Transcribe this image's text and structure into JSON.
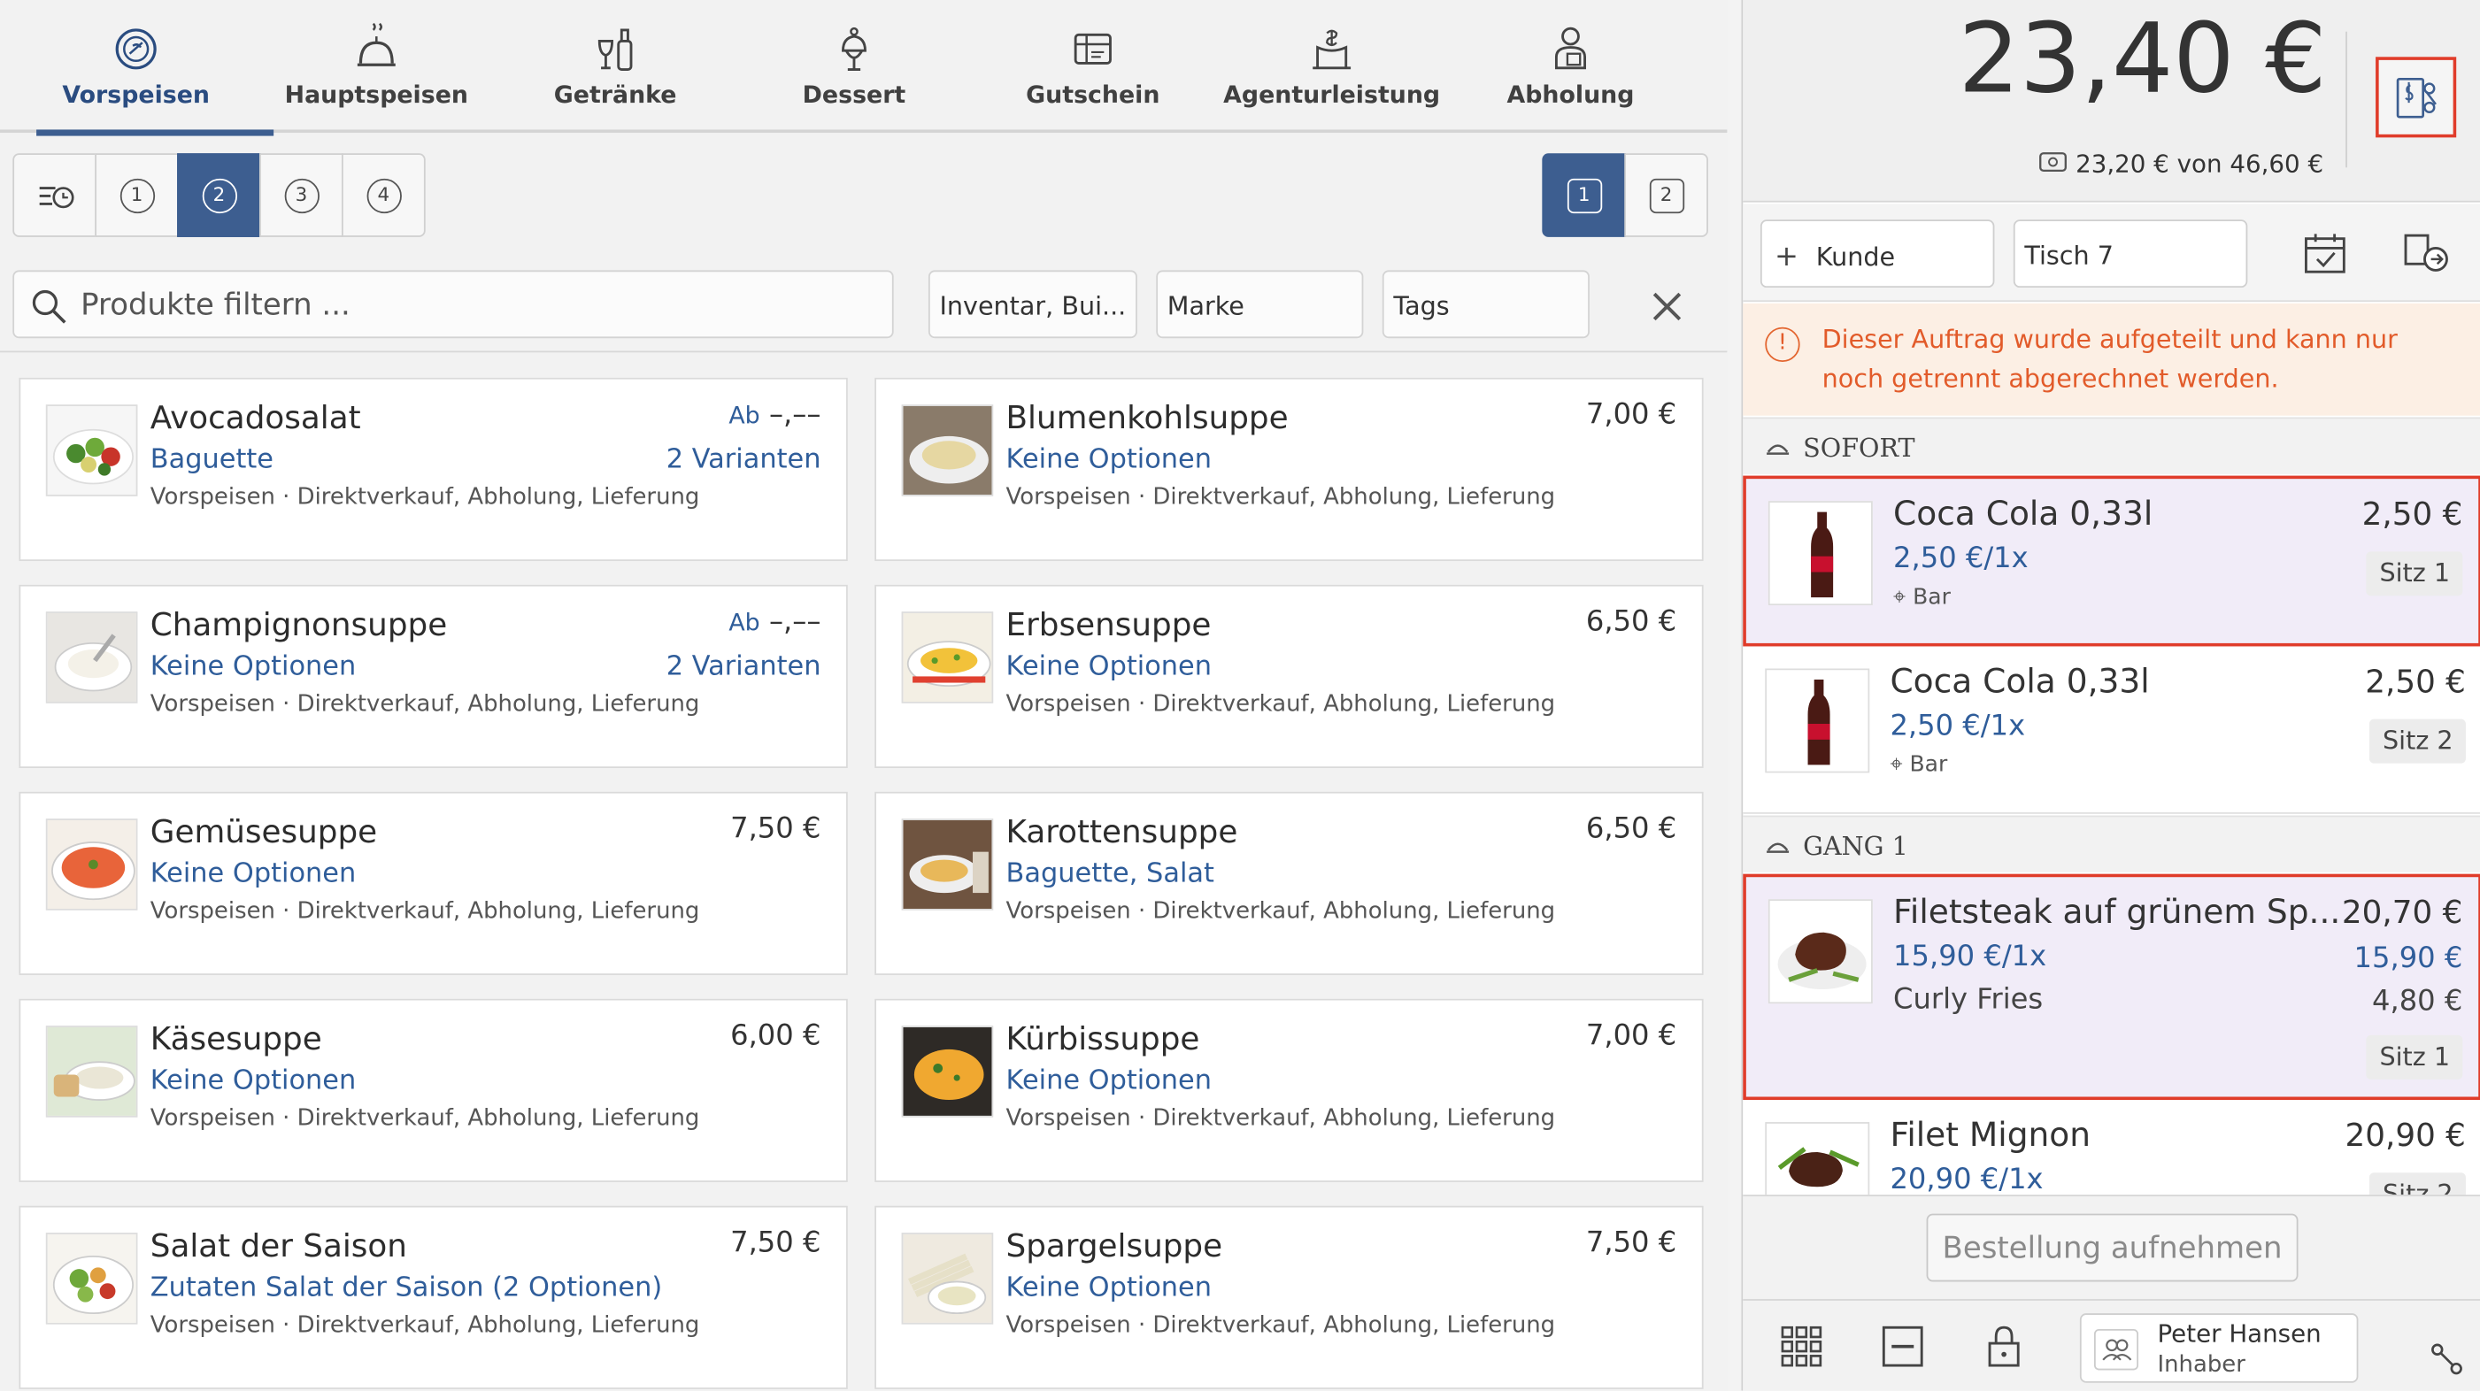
{
  "categories": [
    {
      "label": "Vorspeisen",
      "icon": "salad-bowl-icon",
      "active": true
    },
    {
      "label": "Hauptspeisen",
      "icon": "cloche-icon",
      "active": false
    },
    {
      "label": "Getränke",
      "icon": "drinks-icon",
      "active": false
    },
    {
      "label": "Dessert",
      "icon": "dessert-icon",
      "active": false
    },
    {
      "label": "Gutschein",
      "icon": "voucher-icon",
      "active": false
    },
    {
      "label": "Agenturleistung",
      "icon": "agency-icon",
      "active": false
    },
    {
      "label": "Abholung",
      "icon": "pickup-icon",
      "active": false
    }
  ],
  "courses": [
    "1",
    "2",
    "3",
    "4"
  ],
  "selected_course": "2",
  "seats": [
    "1",
    "2"
  ],
  "selected_seat": "1",
  "search": {
    "placeholder": "Produkte filtern ..."
  },
  "filters": {
    "inventory": "Inventar, Bui...",
    "brand": "Marke",
    "tags": "Tags"
  },
  "products": [
    {
      "name": "Avocadosalat",
      "price_prefix": "Ab",
      "price": "–,––",
      "options": "Baguette",
      "variants": "2 Varianten",
      "meta": "Vorspeisen · Direktverkauf, Abholung, Lieferung",
      "thumb": "salad"
    },
    {
      "name": "Blumenkohlsuppe",
      "price_prefix": "",
      "price": "7,00 €",
      "options": "Keine Optionen",
      "variants": "",
      "meta": "Vorspeisen · Direktverkauf, Abholung, Lieferung",
      "thumb": "creamsoup"
    },
    {
      "name": "Champignonsuppe",
      "price_prefix": "Ab",
      "price": "–,––",
      "options": "Keine Optionen",
      "variants": "2 Varianten",
      "meta": "Vorspeisen · Direktverkauf, Abholung, Lieferung",
      "thumb": "whitesoup"
    },
    {
      "name": "Erbsensuppe",
      "price_prefix": "",
      "price": "6,50 €",
      "options": "Keine Optionen",
      "variants": "",
      "meta": "Vorspeisen · Direktverkauf, Abholung, Lieferung",
      "thumb": "omelette"
    },
    {
      "name": "Gemüsesuppe",
      "price_prefix": "",
      "price": "7,50 €",
      "options": "Keine Optionen",
      "variants": "",
      "meta": "Vorspeisen · Direktverkauf, Abholung, Lieferung",
      "thumb": "tomatosoup"
    },
    {
      "name": "Karottensuppe",
      "price_prefix": "",
      "price": "6,50 €",
      "options": "Baguette, Salat",
      "variants": "",
      "meta": "Vorspeisen · Direktverkauf, Abholung, Lieferung",
      "thumb": "carrotsoup"
    },
    {
      "name": "Käsesuppe",
      "price_prefix": "",
      "price": "6,00 €",
      "options": "Keine Optionen",
      "variants": "",
      "meta": "Vorspeisen · Direktverkauf, Abholung, Lieferung",
      "thumb": "cheesesoup"
    },
    {
      "name": "Kürbissuppe",
      "price_prefix": "",
      "price": "7,00 €",
      "options": "Keine Optionen",
      "variants": "",
      "meta": "Vorspeisen · Direktverkauf, Abholung, Lieferung",
      "thumb": "pumpkinsoup"
    },
    {
      "name": "Salat der Saison",
      "price_prefix": "",
      "price": "7,50 €",
      "options": "Zutaten Salat der Saison (2 Optionen)",
      "variants": "",
      "meta": "Vorspeisen · Direktverkauf, Abholung, Lieferung",
      "thumb": "salad2"
    },
    {
      "name": "Spargelsuppe",
      "price_prefix": "",
      "price": "7,50 €",
      "options": "Keine Optionen",
      "variants": "",
      "meta": "Vorspeisen · Direktverkauf, Abholung, Lieferung",
      "thumb": "asparagus"
    }
  ],
  "order": {
    "total": "23,40 €",
    "paid": "23,20 €",
    "of": "von",
    "gross": "46,60 €",
    "customer_btn": "Kunde",
    "table": "Tisch 7",
    "warning": "Dieser Auftrag wurde aufgeteilt und kann nur noch getrennt abgerechnet werden.",
    "groups": [
      {
        "title": "SOFORT",
        "items": [
          {
            "name": "Coca Cola 0,33l",
            "unit": "2,50 €/1x",
            "location": "Bar",
            "price": "2,50 €",
            "seat": "Sitz 1",
            "highlight": true
          },
          {
            "name": "Coca Cola 0,33l",
            "unit": "2,50 €/1x",
            "location": "Bar",
            "price": "2,50 €",
            "seat": "Sitz 2",
            "highlight": false
          }
        ]
      },
      {
        "title": "GANG 1",
        "items": [
          {
            "name": "Filetsteak auf grünem Sp...",
            "unit": "15,90 €/1x",
            "unit_price": "15,90 €",
            "extra": "Curly Fries",
            "extra_price": "4,80 €",
            "price": "20,70 €",
            "seat": "Sitz 1",
            "highlight": true
          },
          {
            "name": "Filet Mignon",
            "unit": "20,90 €/1x",
            "price": "20,90 €",
            "seat": "Sitz 2",
            "highlight": false
          }
        ]
      }
    ],
    "place_order": "Bestellung aufnehmen"
  },
  "user": {
    "name": "Peter Hansen",
    "role": "Inhaber"
  },
  "colors": {
    "accent": "#3d5e90",
    "link": "#2f5d9a",
    "warning": "#e25b2a",
    "highlight_border": "#e03c2a",
    "highlight_bg": "#f1ecf8"
  }
}
